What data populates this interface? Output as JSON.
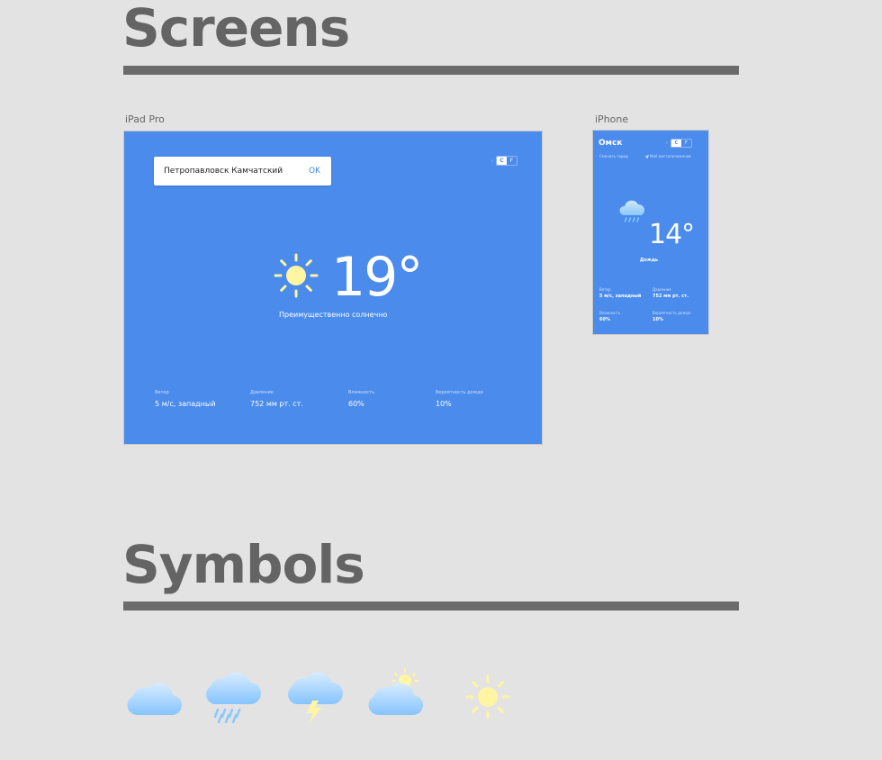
{
  "sections": {
    "screens_title": "Screens",
    "symbols_title": "Symbols"
  },
  "frames": {
    "ipad_label": "iPad Pro",
    "iphone_label": "iPhone"
  },
  "ipad": {
    "search_value": "Петропавловск Камчатский",
    "ok_label": "OK",
    "unit_arrow": "‹",
    "unit_c": "C",
    "unit_f": "F",
    "temperature": "19°",
    "description": "Преимущественно солнечно",
    "stats": [
      {
        "label": "Ветер",
        "value": "5 м/с, западный"
      },
      {
        "label": "Давление",
        "value": "752 мм рт. ст."
      },
      {
        "label": "Влажность",
        "value": "60%"
      },
      {
        "label": "Вероятность дождя",
        "value": "10%"
      }
    ],
    "icon": "sun-icon"
  },
  "iphone": {
    "city": "Омск",
    "unit_arrow": "‹",
    "unit_c": "C",
    "unit_f": "F",
    "change_city": "Сменить город",
    "my_location": "Моё местоположение",
    "temperature": "14°",
    "description": "Дождь",
    "stats": [
      {
        "label": "Ветер",
        "value": "5 м/с, западный"
      },
      {
        "label": "Давление",
        "value": "752 мм рт. ст."
      },
      {
        "label": "Влажность",
        "value": "60%"
      },
      {
        "label": "Вероятность дождя",
        "value": "10%"
      }
    ],
    "icon": "rain-cloud-icon"
  },
  "symbols": [
    "cloud-icon",
    "rain-cloud-icon",
    "thunder-cloud-icon",
    "partly-cloudy-icon",
    "sun-icon"
  ],
  "colors": {
    "background": "#e3e3e3",
    "screen_blue": "#4a8bec",
    "heading_gray": "#646464",
    "sun_yellow": "#fff5a3",
    "cloud_blue": "#8cc8ff"
  }
}
